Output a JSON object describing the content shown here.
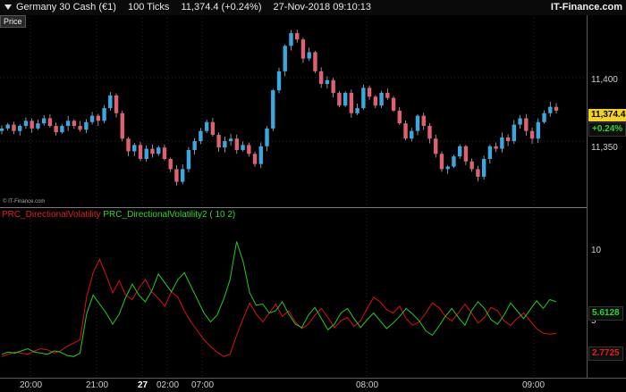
{
  "header": {
    "instrument": "Germany 30 Cash (€1)",
    "period": "100 Ticks",
    "last": "11,374.4 (+0.24%)",
    "datetime": "27-Nov-2018 09:10:13",
    "brand": "IT-Finance.com"
  },
  "price_panel": {
    "tag": "Price",
    "axis_labels": [
      "11,400",
      "11,350"
    ],
    "last_price": "11,374.4",
    "change": "+0.24%",
    "copyright": "© IT-Finance.com"
  },
  "indicator_panel": {
    "label1": "PRC_DirectionalVolatility",
    "label2": "PRC_DirectionalVolatility2",
    "params": "( 10 2)",
    "axis_labels": [
      "10",
      "5"
    ],
    "green_value": "5.6128",
    "red_value": "2.7725"
  },
  "time_axis": {
    "labels": [
      "20:00",
      "21:00",
      "27",
      "02:00",
      "07:00",
      "08:00",
      "09:00"
    ]
  },
  "colors": {
    "up": "#3aa7e0",
    "down": "#e06070",
    "green_line": "#22cc22",
    "red_line": "#dd1111",
    "price_badge": "#f2d21b"
  },
  "chart_data": {
    "type": "line",
    "price_ylim": [
      11310,
      11440
    ],
    "price_close": [
      11360,
      11363,
      11358,
      11362,
      11366,
      11360,
      11364,
      11368,
      11362,
      11357,
      11362,
      11366,
      11362,
      11359,
      11365,
      11370,
      11366,
      11376,
      11386,
      11372,
      11352,
      11342,
      11347,
      11336,
      11344,
      11340,
      11345,
      11336,
      11328,
      11318,
      11328,
      11343,
      11350,
      11358,
      11365,
      11355,
      11345,
      11350,
      11352,
      11343,
      11347,
      11340,
      11332,
      11346,
      11360,
      11390,
      11405,
      11425,
      11435,
      11430,
      11415,
      11420,
      11405,
      11395,
      11398,
      11388,
      11378,
      11388,
      11372,
      11376,
      11392,
      11385,
      11378,
      11388,
      11384,
      11374,
      11364,
      11352,
      11358,
      11370,
      11362,
      11352,
      11340,
      11328,
      11330,
      11338,
      11346,
      11334,
      11328,
      11322,
      11336,
      11346,
      11344,
      11353,
      11350,
      11363,
      11368,
      11358,
      11352,
      11365,
      11372,
      11377,
      11374
    ],
    "series": [
      {
        "name": "PRC_DirectionalVolatility",
        "color": "red",
        "values": [
          0.7,
          0.9,
          1.1,
          1.0,
          0.9,
          1.2,
          1.4,
          1.3,
          1.0,
          1.2,
          1.6,
          1.9,
          2.2,
          6.0,
          8.2,
          9.4,
          8.0,
          6.4,
          7.5,
          6.2,
          5.8,
          6.8,
          7.6,
          6.5,
          5.9,
          5.2,
          6.5,
          6.0,
          4.8,
          3.8,
          3.0,
          2.2,
          1.6,
          1.1,
          0.7,
          0.9,
          2.6,
          4.1,
          5.5,
          4.5,
          3.8,
          4.6,
          5.4,
          4.3,
          4.8,
          3.8,
          3.2,
          3.6,
          4.4,
          5.0,
          4.2,
          3.3,
          3.9,
          4.2,
          3.4,
          3.9,
          5.0,
          6.0,
          5.6,
          4.9,
          4.6,
          5.2,
          4.1,
          3.5,
          3.8,
          4.6,
          5.5,
          5.1,
          4.3,
          3.9,
          4.6,
          5.4,
          4.6,
          3.7,
          4.2,
          5.1,
          4.8,
          3.9,
          3.5,
          4.1,
          4.6,
          3.9,
          3.2,
          2.8,
          2.7,
          2.77
        ]
      },
      {
        "name": "PRC_DirectionalVolatility2",
        "color": "green",
        "values": [
          0.9,
          1.1,
          1.0,
          1.2,
          1.4,
          1.1,
          1.0,
          0.9,
          1.2,
          1.1,
          0.8,
          0.7,
          1.0,
          4.5,
          6.2,
          5.4,
          4.6,
          3.6,
          4.5,
          6.0,
          7.2,
          6.2,
          5.6,
          6.6,
          8.1,
          7.3,
          6.5,
          7.6,
          8.2,
          7.0,
          5.8,
          4.6,
          3.8,
          4.4,
          5.8,
          7.6,
          11.0,
          9.2,
          6.4,
          5.3,
          5.4,
          4.6,
          4.8,
          5.6,
          4.5,
          3.6,
          3.3,
          4.4,
          5.1,
          4.1,
          3.1,
          3.6,
          4.6,
          5.0,
          4.1,
          3.3,
          4.0,
          4.6,
          3.9,
          3.2,
          3.7,
          4.3,
          5.0,
          4.5,
          3.9,
          3.0,
          2.6,
          3.4,
          4.3,
          5.0,
          4.2,
          3.5,
          4.8,
          5.6,
          5.0,
          4.0,
          3.6,
          4.4,
          5.5,
          4.8,
          4.1,
          4.9,
          5.7,
          5.0,
          5.8,
          5.61
        ]
      }
    ],
    "indicator_ylim": [
      0,
      12
    ],
    "x_tick_labels": [
      "20:00",
      "21:00",
      "27",
      "02:00",
      "07:00",
      "08:00",
      "09:00"
    ]
  }
}
